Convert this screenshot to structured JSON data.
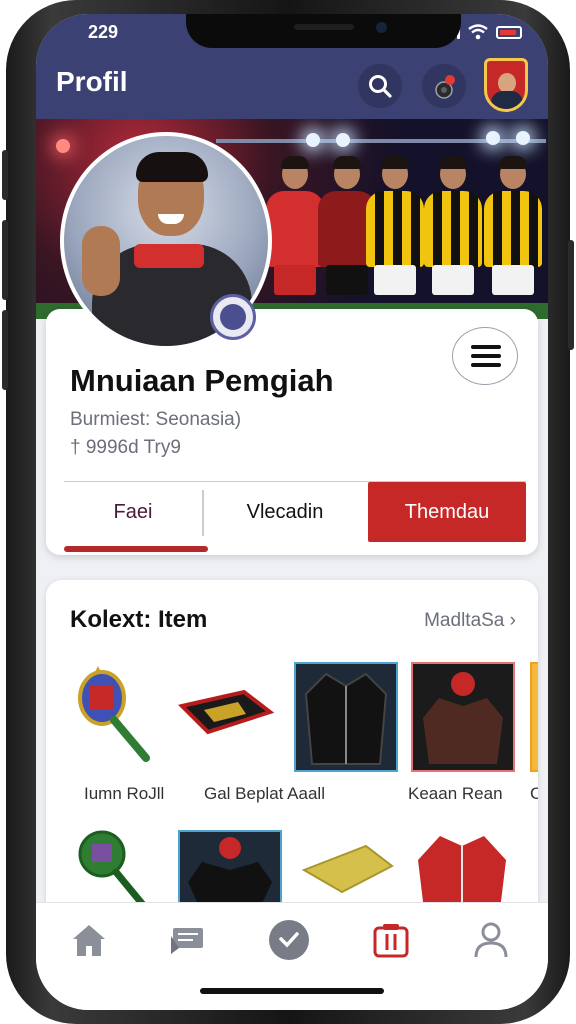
{
  "status_bar": {
    "time": "229"
  },
  "header": {
    "title": "Profil"
  },
  "profile": {
    "name": "Mnuiaan Pemgiah",
    "subtitle": "Burmiest: Seonasia)",
    "meta": "† 9996d Try9"
  },
  "tabs": [
    {
      "label": "Faei",
      "selected": true
    },
    {
      "label": "Vlecadin"
    },
    {
      "label": "Themdau",
      "highlighted": true
    }
  ],
  "collection": {
    "title": "Kolext: Item",
    "more_label": "MadltaSa",
    "items": [
      {
        "label": "Iumn RoJll",
        "icon": "badminton-racket-icon"
      },
      {
        "label": "Gal Beplat Aaall",
        "icon": "flag-patch-icon"
      },
      {
        "label": "Keaan Rean",
        "icon": "leather-jacket-icon"
      },
      {
        "label": "Ca",
        "icon": "partial-item-icon"
      }
    ],
    "items_row2": [
      {
        "icon": "badminton-racket-icon"
      },
      {
        "icon": "jersey-icon"
      },
      {
        "icon": "towel-icon"
      },
      {
        "icon": "red-jacket-icon"
      }
    ]
  },
  "colors": {
    "header": "#3b4273",
    "accent_red": "#c62828",
    "tab_selected_text": "#4a1a3a"
  },
  "bottom_nav": [
    {
      "icon": "home-icon"
    },
    {
      "icon": "news-icon"
    },
    {
      "icon": "activity-icon"
    },
    {
      "icon": "collection-icon",
      "active": true
    },
    {
      "icon": "profile-icon"
    }
  ]
}
